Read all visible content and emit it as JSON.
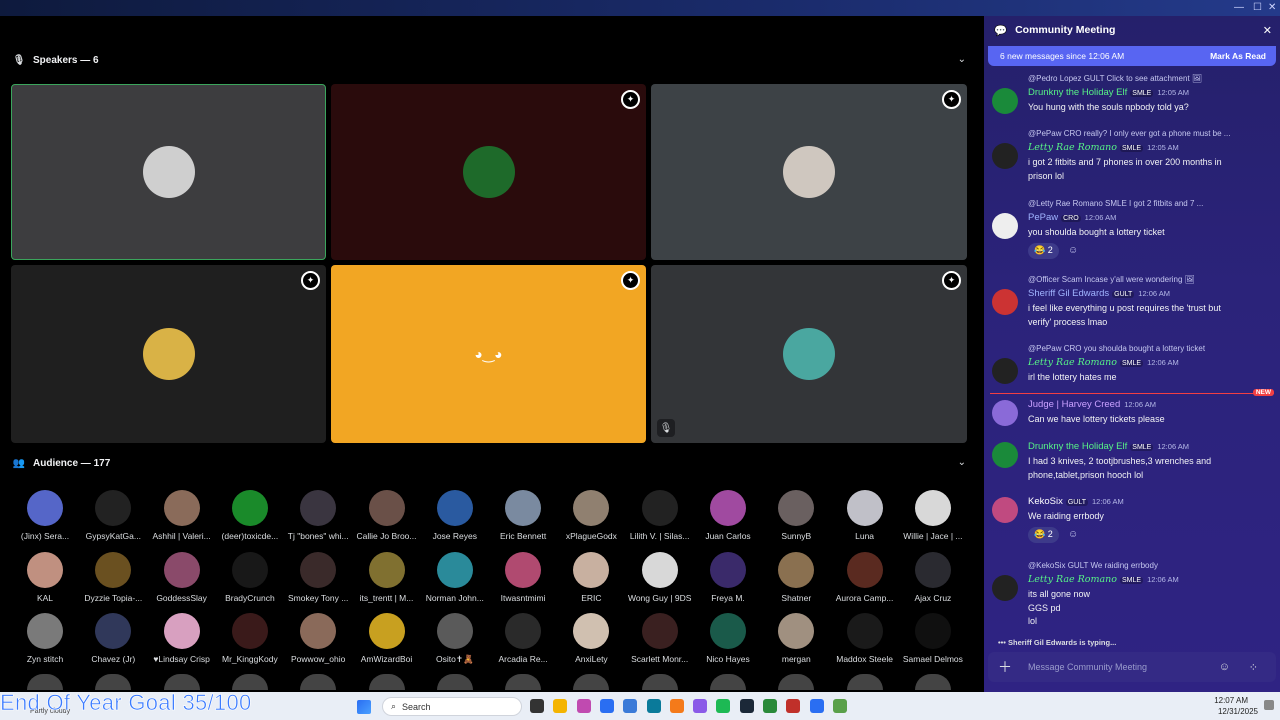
{
  "window": {
    "controls": [
      "—",
      "☐",
      "✕"
    ]
  },
  "speakers": {
    "label": "Speakers — 6"
  },
  "tiles": [
    {
      "bg": "#3d3d3f",
      "av": "#cfcfcf",
      "active": true
    },
    {
      "bg": "#2a0b0c",
      "av": "#1e6a2a",
      "badge": true
    },
    {
      "bg": "#3d4246",
      "av": "#cfc7bf",
      "badge": true
    },
    {
      "bg": "#1f1f1f",
      "av": "#d9b246",
      "badge": true
    },
    {
      "bg": "#f2a623",
      "discord": true,
      "badge": true
    },
    {
      "bg": "#333538",
      "av": "#4aa7a0",
      "badge": true,
      "mute": true
    }
  ],
  "audience": {
    "label": "Audience — 177"
  },
  "audience_members": [
    {
      "name": "(Jinx) Sera...",
      "c": "#5566c8"
    },
    {
      "name": "GypsyKatGa...",
      "c": "#222222"
    },
    {
      "name": "Ashhil | Valeri...",
      "c": "#8a6b5a"
    },
    {
      "name": "(deer)toxicde...",
      "c": "#1a8a2a"
    },
    {
      "name": "Tj \"bones\" whi...",
      "c": "#3a3540"
    },
    {
      "name": "Callie Jo Broo...",
      "c": "#6a5048"
    },
    {
      "name": "Jose Reyes",
      "c": "#2a5aa0"
    },
    {
      "name": "Eric Bennett",
      "c": "#7a8aa0"
    },
    {
      "name": "xPlagueGodx",
      "c": "#908070"
    },
    {
      "name": "Lilith V. | Silas...",
      "c": "#222222"
    },
    {
      "name": "Juan Carlos",
      "c": "#a04aa0"
    },
    {
      "name": "SunnyB",
      "c": "#6a6060"
    },
    {
      "name": "Luna",
      "c": "#c0c0c8"
    },
    {
      "name": "Willie | Jace | ...",
      "c": "#d8d8d8"
    },
    {
      "name": "KAL",
      "c": "#c09080"
    },
    {
      "name": "Dyzzie Topia-...",
      "c": "#6a5020"
    },
    {
      "name": "GoddessSlay",
      "c": "#8a4a6a"
    },
    {
      "name": "BradyCrunch",
      "c": "#181818"
    },
    {
      "name": "Smokey Tony ...",
      "c": "#3a2a2a"
    },
    {
      "name": "its_trentt | M...",
      "c": "#807030"
    },
    {
      "name": "Norman John...",
      "c": "#2a8a9a"
    },
    {
      "name": "Itwasntmimi",
      "c": "#b04a70"
    },
    {
      "name": "ERIC",
      "c": "#c8b0a0"
    },
    {
      "name": "Wong Guy | 9DS",
      "c": "#d8d8d8"
    },
    {
      "name": "Freya M.",
      "c": "#3a2a6a"
    },
    {
      "name": "Shatner",
      "c": "#8a7050"
    },
    {
      "name": "Aurora Camp...",
      "c": "#5a2a20"
    },
    {
      "name": "Ajax Cruz",
      "c": "#2a2a30"
    },
    {
      "name": "Zyn stitch",
      "c": "#7a7a7a"
    },
    {
      "name": "Chavez (Jr)",
      "c": "#30385a"
    },
    {
      "name": "♥Lindsay Crisp",
      "c": "#d8a0c0"
    },
    {
      "name": "Mr_KinggKody",
      "c": "#3a1a1a"
    },
    {
      "name": "Powwow_ohio",
      "c": "#8a6a5a"
    },
    {
      "name": "AmWizardBoi",
      "c": "#c8a020"
    },
    {
      "name": "Osito✝🧸",
      "c": "#5a5a5a"
    },
    {
      "name": "Arcadia Re...",
      "c": "#2a2a2a"
    },
    {
      "name": "AnxiLety",
      "c": "#d0c0b0"
    },
    {
      "name": "Scarlett Monr...",
      "c": "#3a2020"
    },
    {
      "name": "Nico Hayes",
      "c": "#1a5a4a"
    },
    {
      "name": "mergan",
      "c": "#a09080"
    },
    {
      "name": "Maddox Steele",
      "c": "#1a1a1a"
    },
    {
      "name": "Samael Delmos",
      "c": "#101010"
    }
  ],
  "overlay": {
    "goal": "End Of Year Goal 35/100"
  },
  "taskbar": {
    "search": "Search",
    "time": "12:07 AM",
    "date": "12/31/2025",
    "weather": "Partly cloudy"
  },
  "sidebar": {
    "title": "Community Meeting",
    "new_messages": "6 new messages since 12:06 AM",
    "mark_read": "Mark As Read",
    "input_placeholder": "Message Community Meeting",
    "typing": "Sheriff Gil Edwards is typing..."
  },
  "messages": [
    {
      "reply": "@Pedro Lopez  GULT  Click to see attachment 🖼",
      "name": "Drunkny the Holiday Elf",
      "color": "#57f287",
      "tags": [
        "SMLE"
      ],
      "time": "12:05 AM",
      "lines": [
        "You hung with the souls npbody told ya?"
      ]
    },
    {
      "reply": "@PePaw  CRO  really? I only ever got a phone must be ...",
      "name": "Letty Rae Romano",
      "color": "#57f287",
      "tags": [
        "SMLE"
      ],
      "time": "12:05 AM",
      "lines": [
        "i got 2 fitbits and 7 phones in over 200 months in",
        "prison lol"
      ]
    },
    {
      "reply": "@Letty Rae Romano  SMLE  I got 2 fitbits and 7 ...",
      "name": "PePaw",
      "color": "#a0b4ff",
      "tags": [
        "CRO"
      ],
      "time": "12:06 AM",
      "lines": [
        "you shoulda bought a lottery ticket"
      ],
      "reaction": "😂 2"
    },
    {
      "reply": "@Officer Scam  Incase y'all were wondering 🖼",
      "name": "Sheriff Gil Edwards",
      "color": "#a0b4ff",
      "tags": [
        "GULT"
      ],
      "time": "12:06 AM",
      "lines": [
        "i feel like everything u post requires the 'trust but",
        "verify' process lmao"
      ]
    },
    {
      "reply": "@PePaw  CRO  you shoulda bought a lottery ticket",
      "name": "Letty Rae Romano",
      "color": "#57f287",
      "tags": [
        "SMLE"
      ],
      "time": "12:06 AM",
      "lines": [
        "irl the lottery hates me"
      ]
    },
    {
      "name": "Judge | Harvey Creed",
      "color": "#c9a0ff",
      "tags": [],
      "time": "12:06 AM",
      "lines": [
        "Can we have lottery tickets please"
      ],
      "new_label": "NEW"
    },
    {
      "name": "Drunkny the Holiday Elf",
      "color": "#57f287",
      "tags": [
        "SMLE"
      ],
      "time": "12:06 AM",
      "lines": [
        "I had 3 knives, 2 tootjbrushes,3 wrenches and",
        "phone,tablet,prison hooch lol"
      ]
    },
    {
      "name": "KekoSix",
      "color": "#ffffff",
      "tags": [
        "GULT"
      ],
      "time": "12:06 AM",
      "lines": [
        "We raiding errbody"
      ],
      "reaction": "😂 2"
    },
    {
      "reply": "@KekoSix  GULT  We raiding errbody",
      "name": "Letty Rae Romano",
      "color": "#57f287",
      "tags": [
        "SMLE"
      ],
      "time": "12:06 AM",
      "lines": [
        "its all gone now",
        "GGS pd",
        "lol"
      ]
    }
  ]
}
